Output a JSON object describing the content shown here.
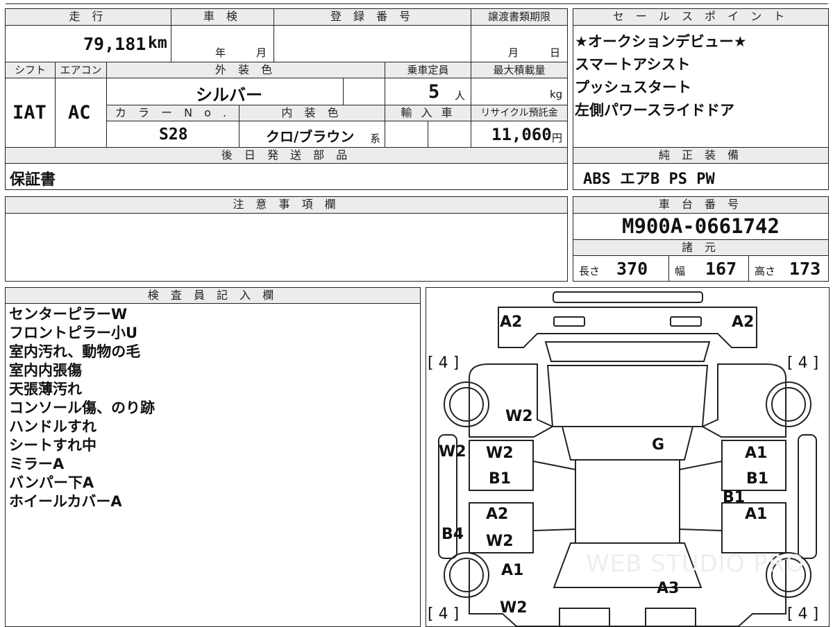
{
  "headers": {
    "mileage": "走 行",
    "inspection": "車 検",
    "registration": "登 録 番 号",
    "transfer_deadline": "譲渡書類期限",
    "sales_point": "セ ー ル ス ポ イ ン ト",
    "shift": "シフト",
    "aircon": "エアコン",
    "exterior_color": "外 装 色",
    "capacity": "乗車定員",
    "max_load": "最大積載量",
    "color_no": "カ ラ ー N o .",
    "interior_color": "内 装 色",
    "import": "輸 入 車",
    "recycle": "リサイクル預託金",
    "later_parts": "後 日 発 送 部 品",
    "genuine_equipment": "純 正 装 備",
    "notes": "注 意 事 項 欄",
    "chassis_number": "車 台 番 号",
    "specs": "諸 元",
    "inspector": "検 査 員 記 入 欄"
  },
  "vehicle": {
    "mileage": "79,181",
    "mileage_unit": "km",
    "inspection_year_unit": "年",
    "inspection_month_unit": "月",
    "transfer_month_unit": "月",
    "transfer_day_unit": "日",
    "shift": "IAT",
    "aircon": "AC",
    "exterior_color": "シルバー",
    "capacity": "5",
    "capacity_unit": "人",
    "max_load_unit": "kg",
    "color_no": "S28",
    "interior_color": "クロ/ブラウン",
    "interior_suffix": "系",
    "recycle_fee": "11,060",
    "recycle_unit": "円",
    "later_parts": "保証書",
    "genuine_equipment": "ABS エアB PS PW",
    "chassis_number": "M900A-0661742",
    "length_label": "長さ",
    "length": "370",
    "width_label": "幅",
    "width": "167",
    "height_label": "高さ",
    "height": "173"
  },
  "sales_points": [
    "★オークションデビュー★",
    "スマートアシスト",
    "プッシュスタート",
    "左側パワースライドドア"
  ],
  "inspector_notes": [
    "センターピラーW",
    "フロントピラー小U",
    "室内汚れ、動物の毛",
    "室内内張傷",
    "天張薄汚れ",
    "コンソール傷、のり跡",
    "ハンドルすれ",
    "シートすれ中",
    "ミラーA",
    "バンパー下A",
    "ホイールカバーA"
  ],
  "diagram": {
    "tire_marks": [
      "[ 4 ]",
      "[ 4 ]",
      "[ 4 ]",
      "[ 4 ]"
    ],
    "marks": {
      "front_left_corner": "A2",
      "front_right_corner": "A2",
      "hood_left": "W2",
      "roof_front": "G",
      "left_sill": "W2",
      "left_front_door_1": "W2",
      "left_front_door_2": "B1",
      "left_rear_door_1": "A2",
      "left_rear_door_2": "W2",
      "left_rear_sill": "B4",
      "left_rear_fender": "A1",
      "rear_left": "W2",
      "right_front_door_1": "A1",
      "right_front_door_2": "B1",
      "right_pillar": "B1",
      "right_rear_door": "A1",
      "rear_right": "A3"
    },
    "watermark": "WEB STUDIO PRO"
  }
}
